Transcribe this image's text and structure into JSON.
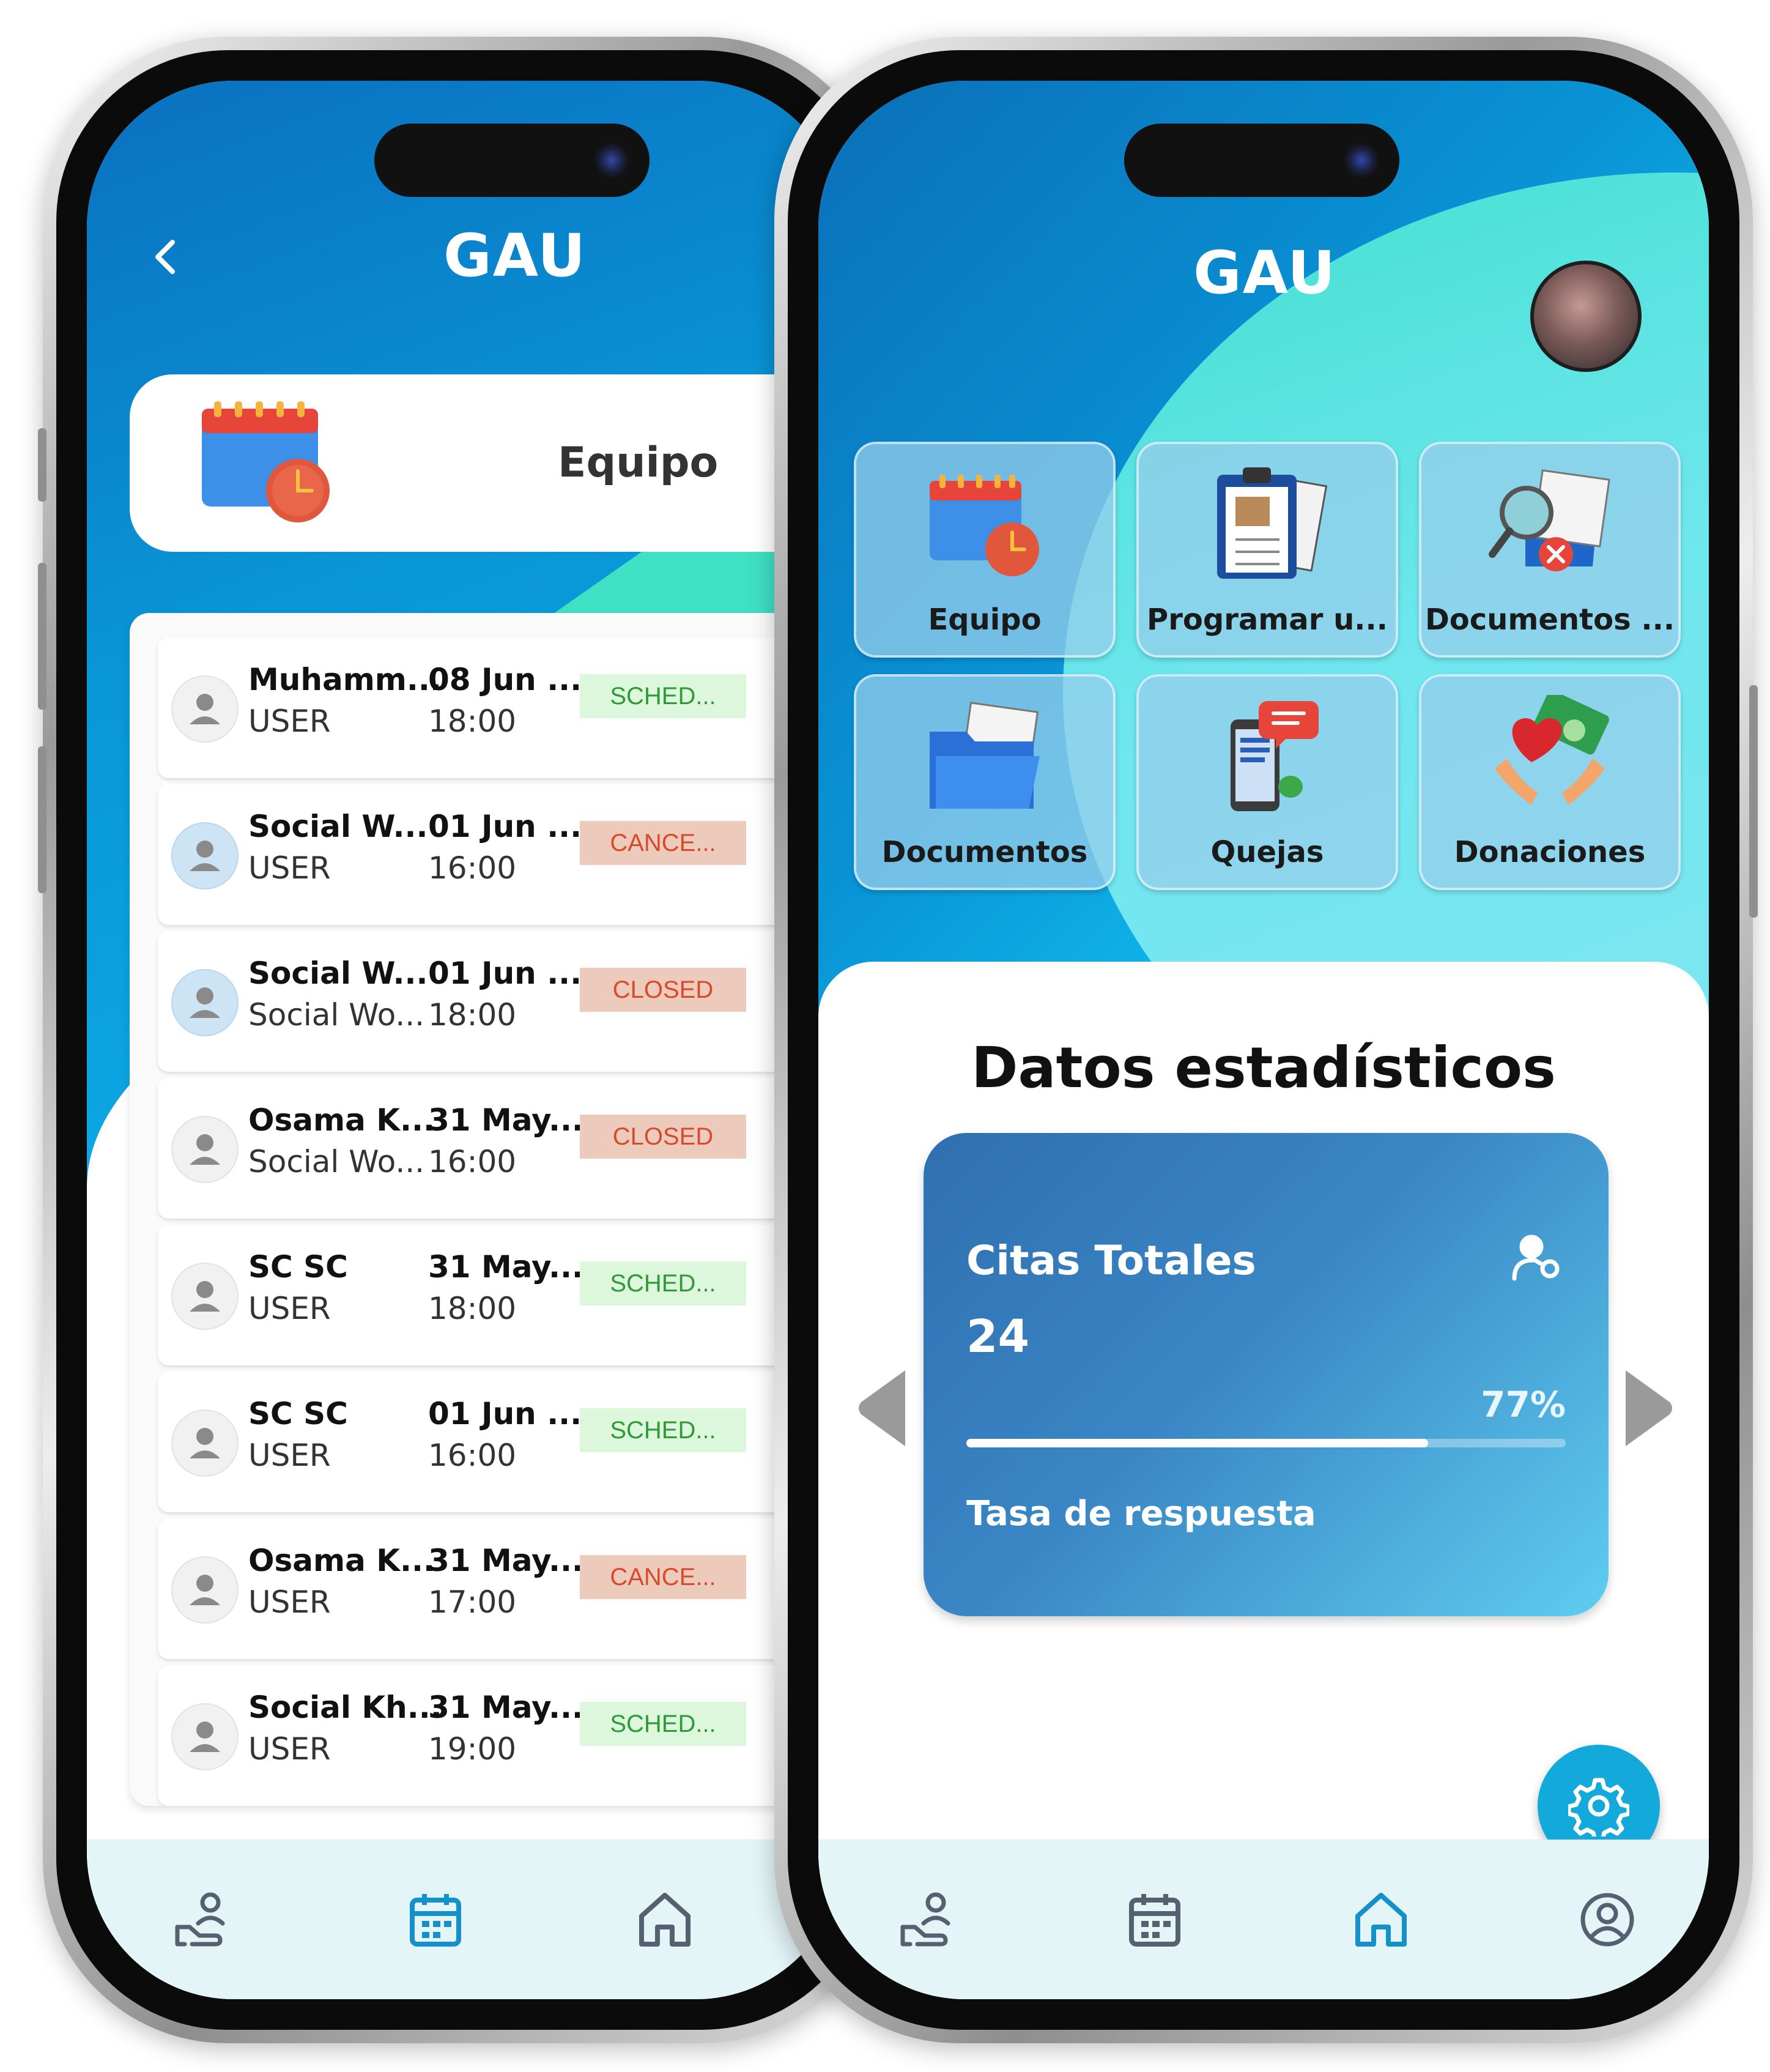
{
  "left_screen": {
    "title": "GAU",
    "header_card": {
      "label": "Equipo"
    },
    "appointments": [
      {
        "name": "Muhamm...",
        "role": "USER",
        "date": "08 Jun ...",
        "time": "18:00",
        "status": "SCHED...",
        "status_type": "sched",
        "avatar": "grey"
      },
      {
        "name": "Social W...",
        "role": "USER",
        "date": "01 Jun ...",
        "time": "16:00",
        "status": "CANCE...",
        "status_type": "cancel",
        "avatar": "blue"
      },
      {
        "name": "Social W...",
        "role": "Social Wo...",
        "date": "01 Jun ...",
        "time": "18:00",
        "status": "CLOSED",
        "status_type": "closed",
        "avatar": "blue"
      },
      {
        "name": "Osama K...",
        "role": "Social Wo...",
        "date": "31 May...",
        "time": "16:00",
        "status": "CLOSED",
        "status_type": "closed",
        "avatar": "grey"
      },
      {
        "name": "SC SC",
        "role": "USER",
        "date": "31 May...",
        "time": "18:00",
        "status": "SCHED...",
        "status_type": "sched",
        "avatar": "grey"
      },
      {
        "name": "SC SC",
        "role": "USER",
        "date": "01 Jun ...",
        "time": "16:00",
        "status": "SCHED...",
        "status_type": "sched",
        "avatar": "grey"
      },
      {
        "name": "Osama K...",
        "role": "USER",
        "date": "31 May...",
        "time": "17:00",
        "status": "CANCE...",
        "status_type": "cancel",
        "avatar": "grey"
      },
      {
        "name": "Social Kh...",
        "role": "USER",
        "date": "31 May...",
        "time": "19:00",
        "status": "SCHED...",
        "status_type": "sched",
        "avatar": "grey"
      }
    ],
    "bottom_nav": [
      {
        "icon": "hand-user-icon",
        "active": false
      },
      {
        "icon": "calendar-icon",
        "active": true
      },
      {
        "icon": "home-icon",
        "active": false
      }
    ]
  },
  "right_screen": {
    "title": "GAU",
    "tiles": [
      {
        "label": "Equipo",
        "icon": "calendar-clock-icon"
      },
      {
        "label": "Programar u...",
        "icon": "clipboard-icon"
      },
      {
        "label": "Documentos ...",
        "icon": "document-search-icon"
      },
      {
        "label": "Documentos",
        "icon": "folder-icon"
      },
      {
        "label": "Quejas",
        "icon": "phone-message-icon"
      },
      {
        "label": "Donaciones",
        "icon": "donation-hands-icon"
      }
    ],
    "stats": {
      "title": "Datos estadísticos",
      "card_title": "Citas Totales",
      "card_value": "24",
      "card_percent": "77%",
      "card_percent_value": 0.77,
      "card_subtitle": "Tasa de respuesta"
    },
    "bottom_nav": [
      {
        "icon": "hand-user-icon",
        "active": false
      },
      {
        "icon": "calendar-icon",
        "active": false
      },
      {
        "icon": "home-icon",
        "active": true
      },
      {
        "icon": "profile-icon",
        "active": false
      }
    ]
  },
  "colors": {
    "accent": "#13a9db",
    "sched_bg": "#ddf7dd",
    "sched_text": "#2f9a36",
    "cancel_bg": "#eccbbd",
    "cancel_text": "#d94a2a",
    "nav_active": "#1590c8",
    "nav_inactive": "#556070"
  }
}
